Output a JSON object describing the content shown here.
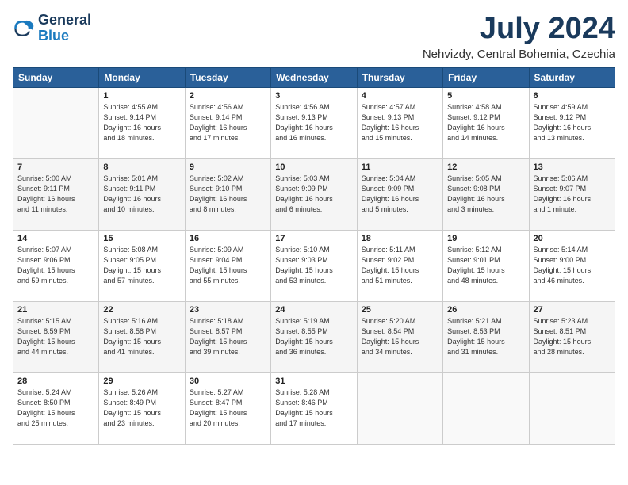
{
  "header": {
    "logo_line1": "General",
    "logo_line2": "Blue",
    "month_title": "July 2024",
    "location": "Nehvizdy, Central Bohemia, Czechia"
  },
  "days_of_week": [
    "Sunday",
    "Monday",
    "Tuesday",
    "Wednesday",
    "Thursday",
    "Friday",
    "Saturday"
  ],
  "weeks": [
    [
      {
        "day": "",
        "text": ""
      },
      {
        "day": "1",
        "text": "Sunrise: 4:55 AM\nSunset: 9:14 PM\nDaylight: 16 hours\nand 18 minutes."
      },
      {
        "day": "2",
        "text": "Sunrise: 4:56 AM\nSunset: 9:14 PM\nDaylight: 16 hours\nand 17 minutes."
      },
      {
        "day": "3",
        "text": "Sunrise: 4:56 AM\nSunset: 9:13 PM\nDaylight: 16 hours\nand 16 minutes."
      },
      {
        "day": "4",
        "text": "Sunrise: 4:57 AM\nSunset: 9:13 PM\nDaylight: 16 hours\nand 15 minutes."
      },
      {
        "day": "5",
        "text": "Sunrise: 4:58 AM\nSunset: 9:12 PM\nDaylight: 16 hours\nand 14 minutes."
      },
      {
        "day": "6",
        "text": "Sunrise: 4:59 AM\nSunset: 9:12 PM\nDaylight: 16 hours\nand 13 minutes."
      }
    ],
    [
      {
        "day": "7",
        "text": "Sunrise: 5:00 AM\nSunset: 9:11 PM\nDaylight: 16 hours\nand 11 minutes."
      },
      {
        "day": "8",
        "text": "Sunrise: 5:01 AM\nSunset: 9:11 PM\nDaylight: 16 hours\nand 10 minutes."
      },
      {
        "day": "9",
        "text": "Sunrise: 5:02 AM\nSunset: 9:10 PM\nDaylight: 16 hours\nand 8 minutes."
      },
      {
        "day": "10",
        "text": "Sunrise: 5:03 AM\nSunset: 9:09 PM\nDaylight: 16 hours\nand 6 minutes."
      },
      {
        "day": "11",
        "text": "Sunrise: 5:04 AM\nSunset: 9:09 PM\nDaylight: 16 hours\nand 5 minutes."
      },
      {
        "day": "12",
        "text": "Sunrise: 5:05 AM\nSunset: 9:08 PM\nDaylight: 16 hours\nand 3 minutes."
      },
      {
        "day": "13",
        "text": "Sunrise: 5:06 AM\nSunset: 9:07 PM\nDaylight: 16 hours\nand 1 minute."
      }
    ],
    [
      {
        "day": "14",
        "text": "Sunrise: 5:07 AM\nSunset: 9:06 PM\nDaylight: 15 hours\nand 59 minutes."
      },
      {
        "day": "15",
        "text": "Sunrise: 5:08 AM\nSunset: 9:05 PM\nDaylight: 15 hours\nand 57 minutes."
      },
      {
        "day": "16",
        "text": "Sunrise: 5:09 AM\nSunset: 9:04 PM\nDaylight: 15 hours\nand 55 minutes."
      },
      {
        "day": "17",
        "text": "Sunrise: 5:10 AM\nSunset: 9:03 PM\nDaylight: 15 hours\nand 53 minutes."
      },
      {
        "day": "18",
        "text": "Sunrise: 5:11 AM\nSunset: 9:02 PM\nDaylight: 15 hours\nand 51 minutes."
      },
      {
        "day": "19",
        "text": "Sunrise: 5:12 AM\nSunset: 9:01 PM\nDaylight: 15 hours\nand 48 minutes."
      },
      {
        "day": "20",
        "text": "Sunrise: 5:14 AM\nSunset: 9:00 PM\nDaylight: 15 hours\nand 46 minutes."
      }
    ],
    [
      {
        "day": "21",
        "text": "Sunrise: 5:15 AM\nSunset: 8:59 PM\nDaylight: 15 hours\nand 44 minutes."
      },
      {
        "day": "22",
        "text": "Sunrise: 5:16 AM\nSunset: 8:58 PM\nDaylight: 15 hours\nand 41 minutes."
      },
      {
        "day": "23",
        "text": "Sunrise: 5:18 AM\nSunset: 8:57 PM\nDaylight: 15 hours\nand 39 minutes."
      },
      {
        "day": "24",
        "text": "Sunrise: 5:19 AM\nSunset: 8:55 PM\nDaylight: 15 hours\nand 36 minutes."
      },
      {
        "day": "25",
        "text": "Sunrise: 5:20 AM\nSunset: 8:54 PM\nDaylight: 15 hours\nand 34 minutes."
      },
      {
        "day": "26",
        "text": "Sunrise: 5:21 AM\nSunset: 8:53 PM\nDaylight: 15 hours\nand 31 minutes."
      },
      {
        "day": "27",
        "text": "Sunrise: 5:23 AM\nSunset: 8:51 PM\nDaylight: 15 hours\nand 28 minutes."
      }
    ],
    [
      {
        "day": "28",
        "text": "Sunrise: 5:24 AM\nSunset: 8:50 PM\nDaylight: 15 hours\nand 25 minutes."
      },
      {
        "day": "29",
        "text": "Sunrise: 5:26 AM\nSunset: 8:49 PM\nDaylight: 15 hours\nand 23 minutes."
      },
      {
        "day": "30",
        "text": "Sunrise: 5:27 AM\nSunset: 8:47 PM\nDaylight: 15 hours\nand 20 minutes."
      },
      {
        "day": "31",
        "text": "Sunrise: 5:28 AM\nSunset: 8:46 PM\nDaylight: 15 hours\nand 17 minutes."
      },
      {
        "day": "",
        "text": ""
      },
      {
        "day": "",
        "text": ""
      },
      {
        "day": "",
        "text": ""
      }
    ]
  ]
}
